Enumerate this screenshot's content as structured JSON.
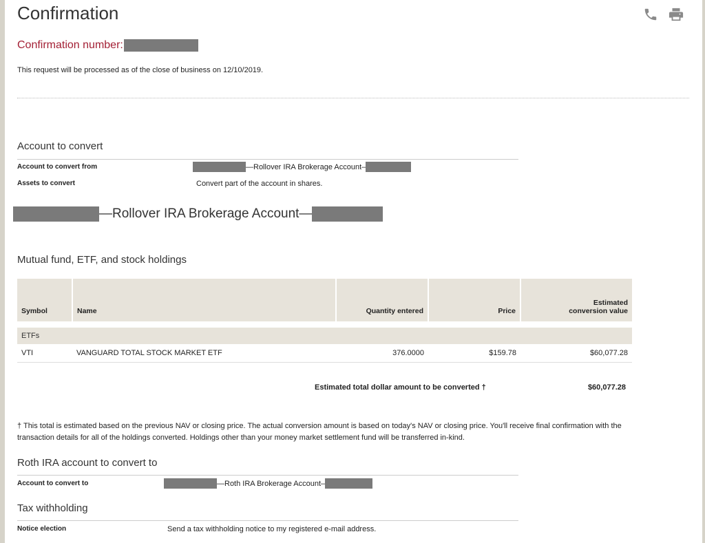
{
  "page_title": "Confirmation",
  "icons": {
    "phone": "phone-icon",
    "print": "print-icon"
  },
  "confirmation": {
    "label": "Confirmation number:",
    "value_redacted": true
  },
  "intro_text": "This request will be processed as of the close of business on 12/10/2019.",
  "account_to_convert": {
    "heading": "Account to convert",
    "rows": [
      {
        "label": "Account to convert from",
        "value": "—Rollover IRA Brokerage Account–"
      },
      {
        "label": "Assets to convert",
        "value": "Convert part of the account in shares."
      }
    ]
  },
  "account_heading": "—Rollover IRA Brokerage Account—",
  "holdings": {
    "heading": "Mutual fund, ETF, and stock holdings",
    "columns": {
      "symbol": "Symbol",
      "name": "Name",
      "quantity": "Quantity entered",
      "price": "Price",
      "value_line1": "Estimated",
      "value_line2": "conversion value"
    },
    "group_label": "ETFs",
    "rows": [
      {
        "symbol": "VTI",
        "name": "VANGUARD TOTAL STOCK MARKET ETF",
        "quantity": "376.0000",
        "price": "$159.78",
        "value": "$60,077.28"
      }
    ]
  },
  "total": {
    "label": "Estimated total dollar amount to be converted †",
    "value": "$60,077.28"
  },
  "footnote": "† This total is estimated based on the previous NAV or closing price. The actual conversion amount is based on today's NAV or closing price. You'll receive final confirmation with the transaction details for all of the holdings converted. Holdings other than your money market settlement fund will be transferred in-kind.",
  "roth": {
    "heading": "Roth IRA account to convert to",
    "label": "Account to convert to",
    "value": "—Roth IRA Brokerage Account–"
  },
  "tax": {
    "heading": "Tax withholding",
    "label": "Notice election",
    "value": "Send a tax withholding notice to my registered e-mail address."
  },
  "colors": {
    "accent_red": "#a31f34",
    "table_header_bg": "#e7e3da",
    "redaction": "#7a7a7a",
    "icon": "#8a8a8a"
  }
}
